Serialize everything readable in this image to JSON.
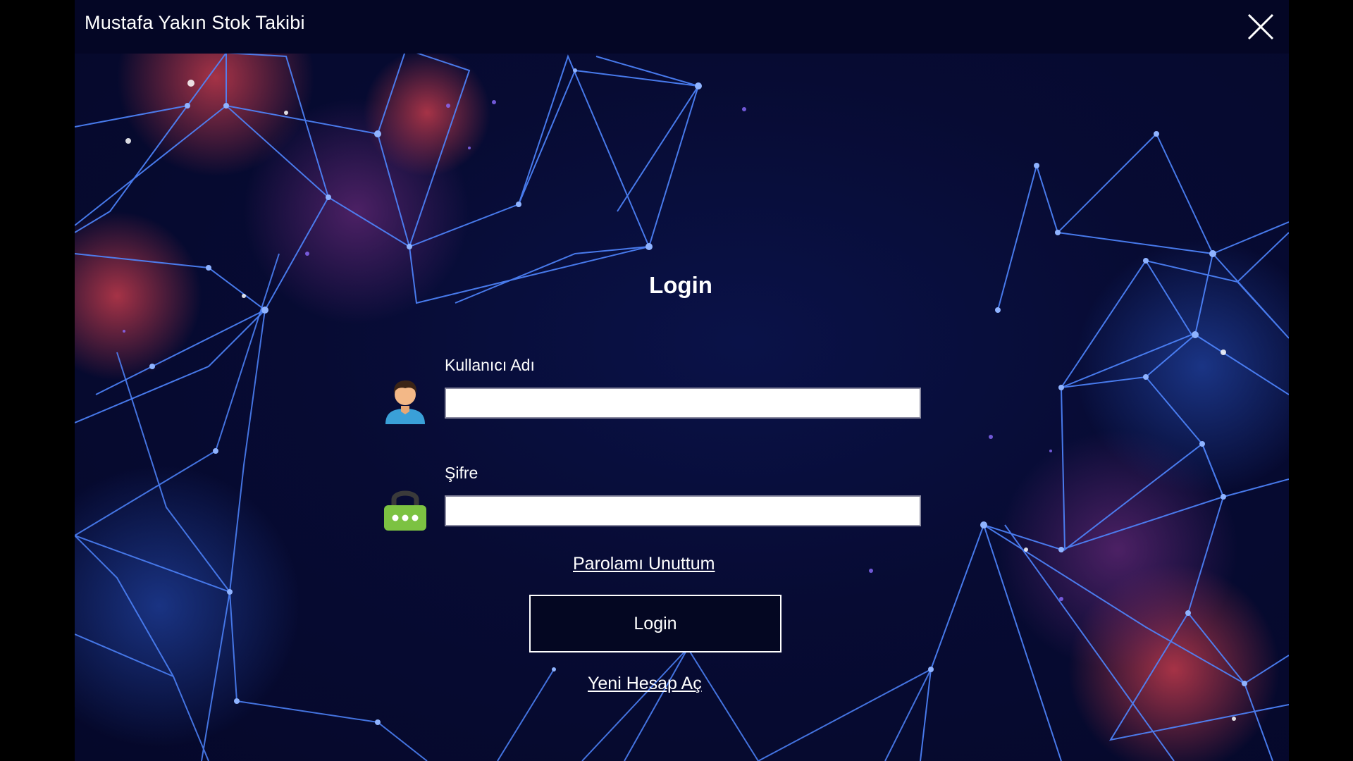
{
  "window": {
    "title": "Mustafa Yakın Stok Takibi",
    "close_icon": "close-icon"
  },
  "form": {
    "heading": "Login",
    "username": {
      "label": "Kullanıcı Adı",
      "value": "",
      "icon": "user-icon"
    },
    "password": {
      "label": "Şifre",
      "value": "",
      "icon": "lock-icon"
    },
    "forgot_link": "Parolamı Unuttum",
    "login_button": "Login",
    "register_link": "Yeni Hesap Aç"
  },
  "colors": {
    "background": "#05082a",
    "titlebar": "#040625",
    "accent_lines": "#4a7dff",
    "text": "#ffffff",
    "lock_green": "#7cc242",
    "user_shirt": "#3aa0d8"
  }
}
